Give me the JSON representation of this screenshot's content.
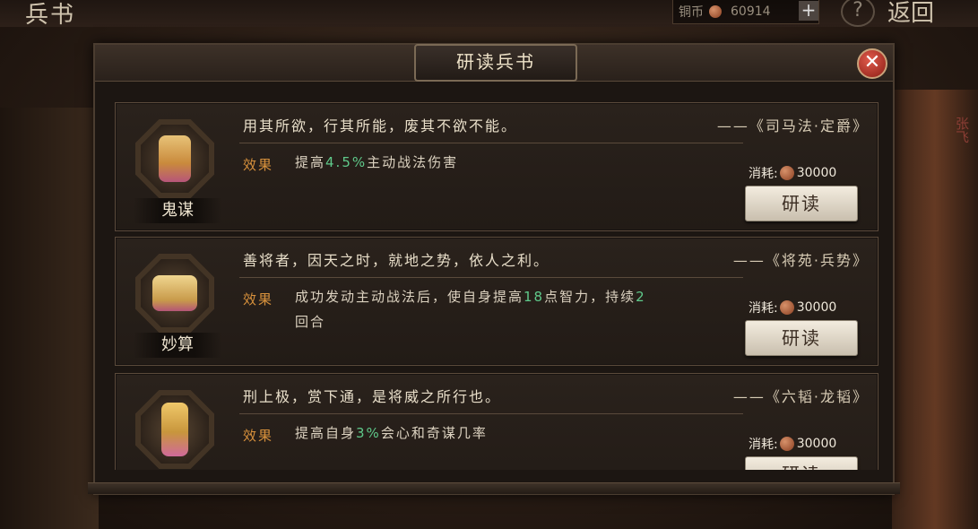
{
  "header": {
    "page_title": "兵书",
    "coin_label": "铜币",
    "coin_amount": "60914",
    "plus": "+",
    "help": "?",
    "back": "返回"
  },
  "side": {
    "right_character_name": "张飞"
  },
  "dialog": {
    "title": "研读兵书",
    "close": "✕",
    "cards": [
      {
        "name": "鬼谋",
        "quote": "用其所欲，行其所能，废其不欲不能。",
        "source": "——《司马法·定爵》",
        "effect_label": "效果",
        "effect_pre": "提高",
        "effect_value": "4.5%",
        "effect_post": "主动战法伤害",
        "effect_value2": "",
        "effect_post2": "",
        "cost_label": "消耗:",
        "cost_amount": "30000",
        "button": "研读"
      },
      {
        "name": "妙算",
        "quote": "善将者，因天之时，就地之势，依人之利。",
        "source": "——《将苑·兵势》",
        "effect_label": "效果",
        "effect_pre": "成功发动主动战法后，使自身提高",
        "effect_value": "18",
        "effect_post": "点智力，持续",
        "effect_value2": "2",
        "effect_post2": "回合",
        "cost_label": "消耗:",
        "cost_amount": "30000",
        "button": "研读"
      },
      {
        "name": "",
        "quote": "刑上极，赏下通，是将威之所行也。",
        "source": "——《六韬·龙韬》",
        "effect_label": "效果",
        "effect_pre": "提高自身",
        "effect_value": "3%",
        "effect_post": "会心和奇谋几率",
        "effect_value2": "",
        "effect_post2": "",
        "cost_label": "消耗:",
        "cost_amount": "30000",
        "button": "研读"
      }
    ]
  }
}
